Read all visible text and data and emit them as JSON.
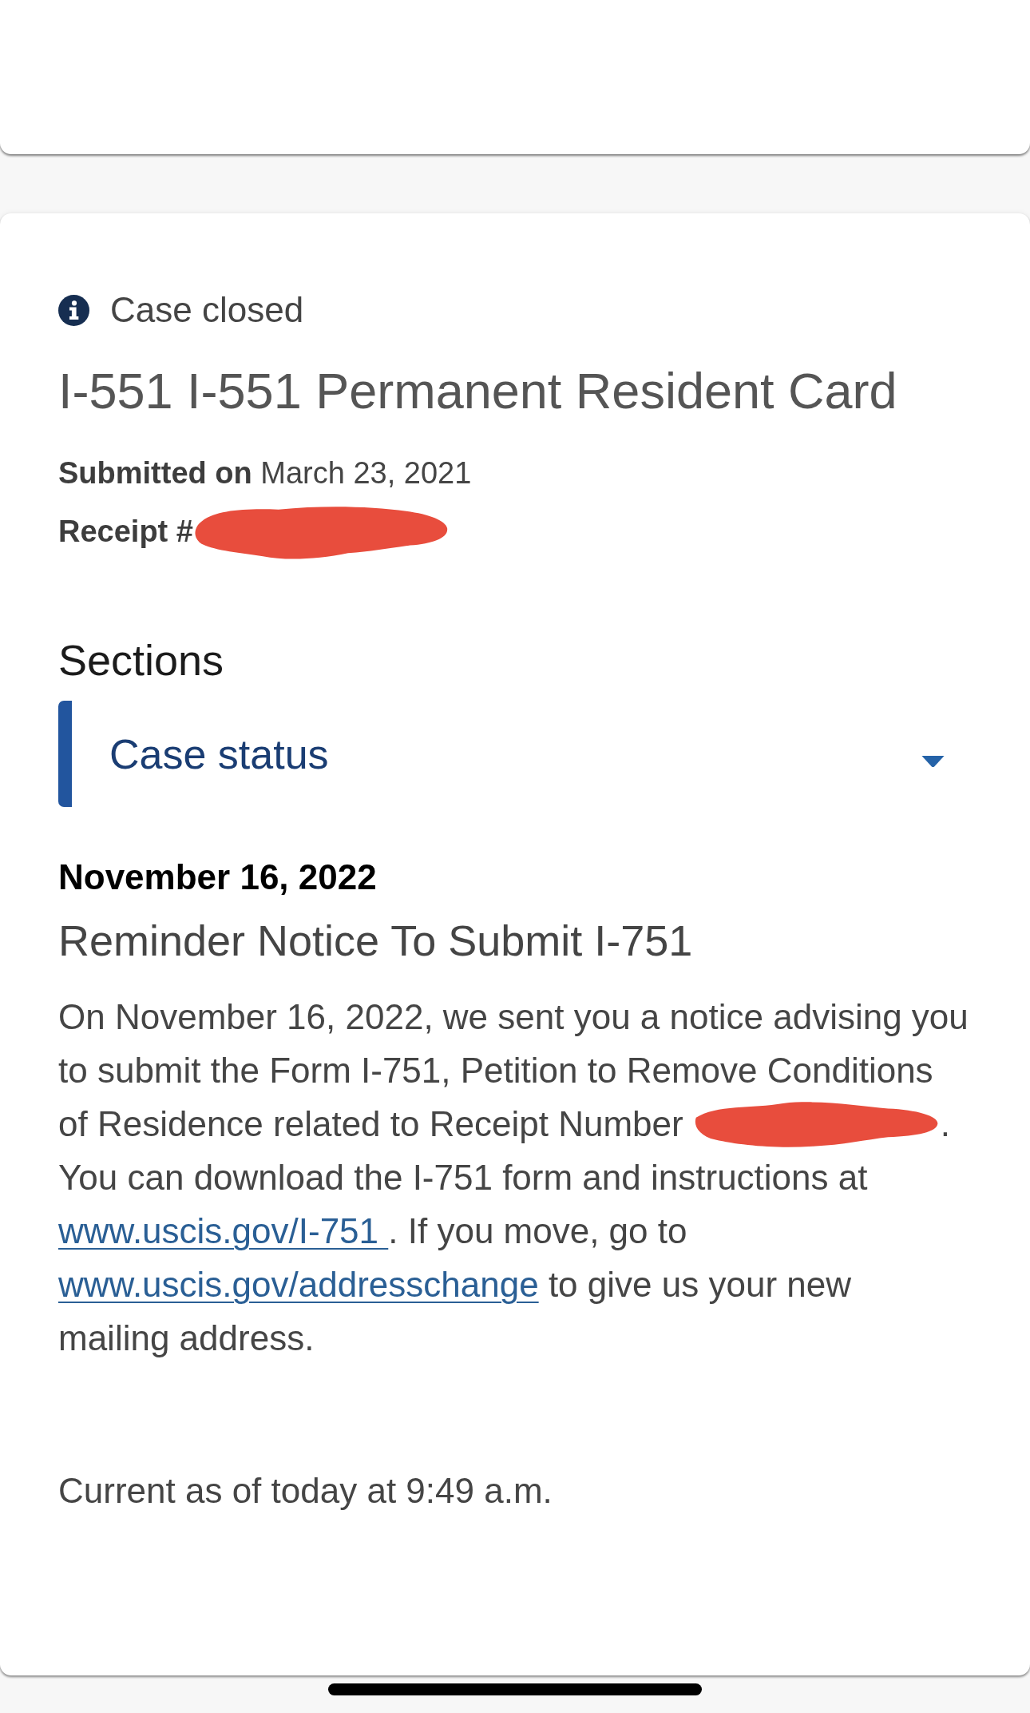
{
  "case": {
    "status": "Case closed",
    "title": "I-551 I-551 Permanent Resident Card",
    "submitted": "**Submitted on** March 23, 2021",
    "receipt": {
      "label": "Receipt #",
      "redacted": true
    }
  },
  "sections": {
    "heading": "Sections",
    "items": [
      {
        "label": "Case status"
      }
    ]
  },
  "history": [
    {
      "date": "November 16, 2022",
      "title": "Reminder Notice To Submit I-751",
      "body": [
        {
          "kind": "text",
          "text": "On November 16, 2022, we sent you a notice advising you to submit the Form I-751, Petition to Remove Conditions of Residence related to Receipt Number "
        },
        {
          "kind": "redaction"
        },
        {
          "kind": "text",
          "text": ". You can download the I-751 form and instructions at "
        },
        {
          "kind": "link",
          "text": "www.uscis.gov/I-751 "
        },
        {
          "kind": "text",
          "text": ". If you move, go to "
        },
        {
          "kind": "link",
          "text": "www.uscis.gov/addresschange"
        },
        {
          "kind": "text",
          "text": " to give us your new mailing address."
        }
      ]
    }
  ],
  "updated": "Current as of today at 9:49 a.m."
}
